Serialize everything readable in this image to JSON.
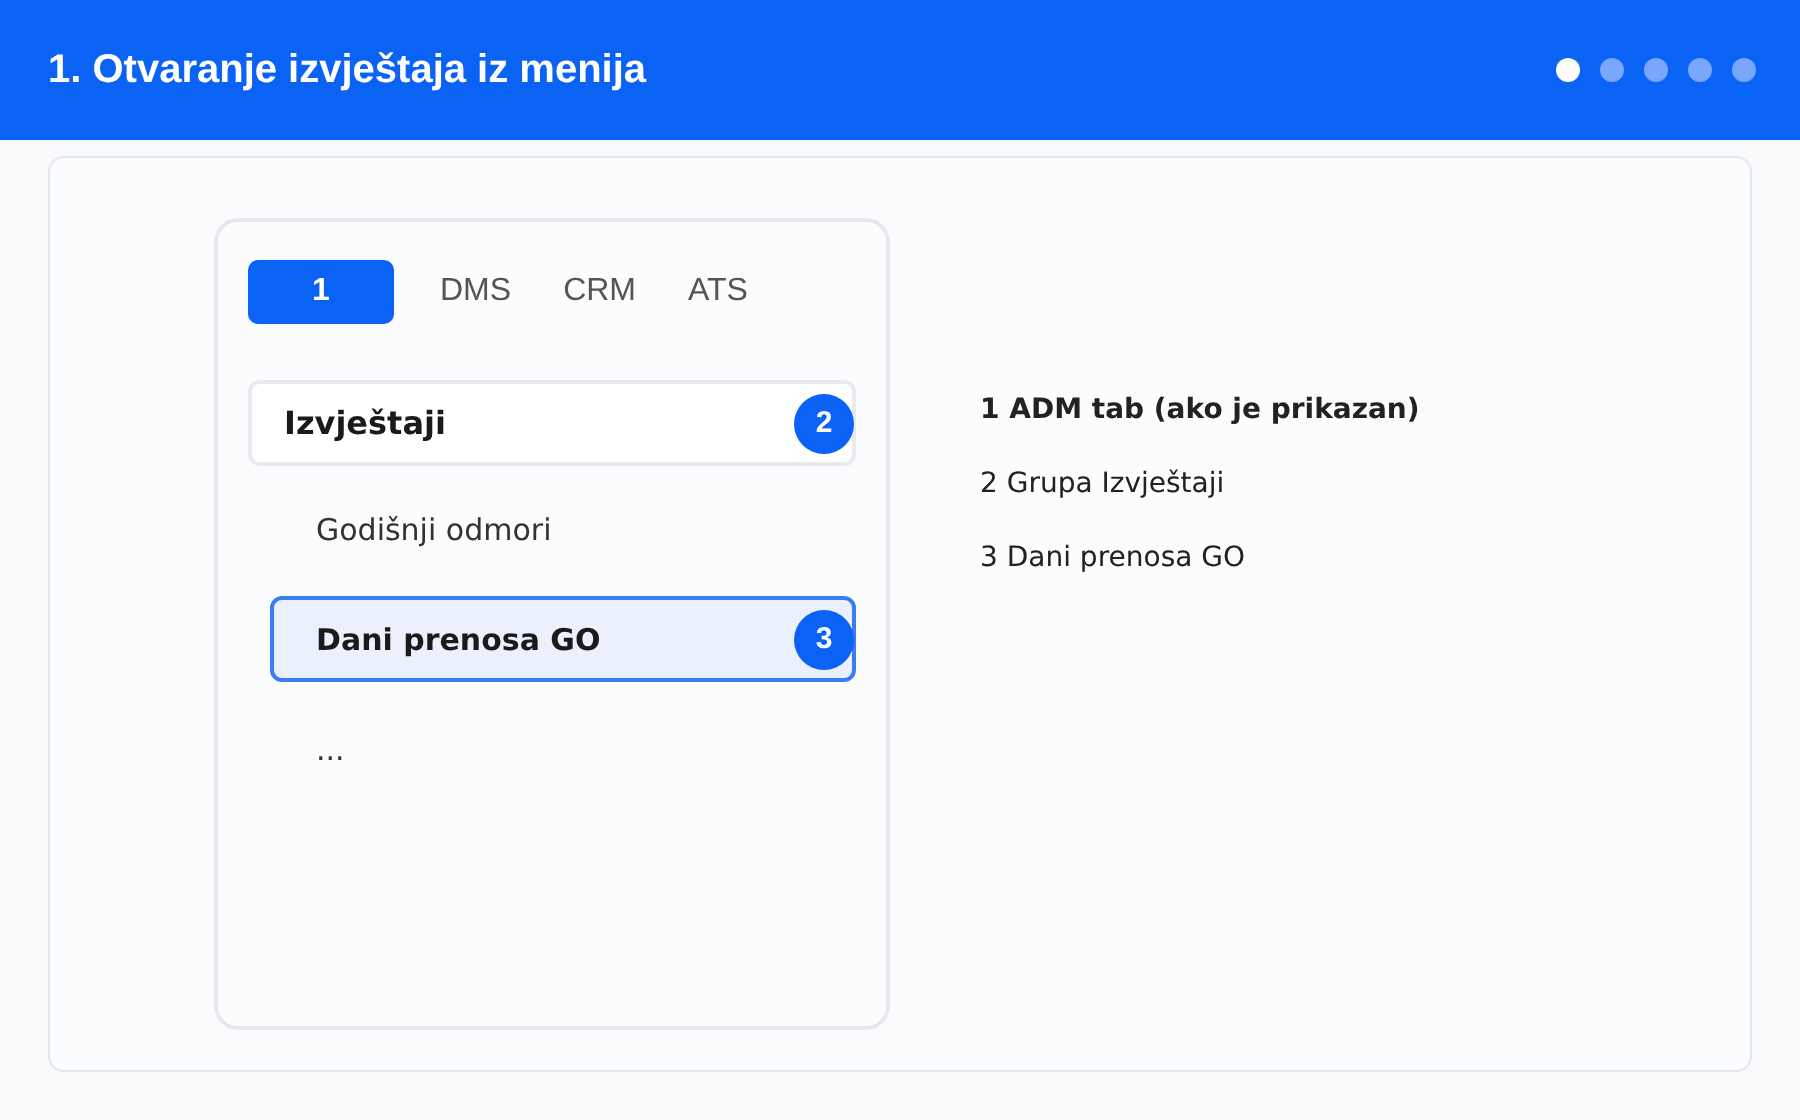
{
  "header": {
    "title": "1. Otvaranje izvještaja iz menija",
    "steps": [
      {
        "selected": true
      },
      {
        "selected": false
      },
      {
        "selected": false
      },
      {
        "selected": false
      },
      {
        "selected": false
      }
    ]
  },
  "menu": {
    "tabs": [
      {
        "selected": true,
        "badge": "1"
      },
      {
        "label": "DMS",
        "selected": false
      },
      {
        "label": "CRM",
        "selected": false
      },
      {
        "label": "ATS",
        "selected": false
      }
    ],
    "group": {
      "label": "Izvještaji",
      "badge": "2"
    },
    "items": [
      {
        "label": "Godišnji odmori",
        "selected": false
      },
      {
        "label": "Dani prenosa GO",
        "selected": true,
        "badge": "3"
      },
      {
        "label": "...",
        "selected": false
      }
    ]
  },
  "legend": [
    {
      "text": "1 ADM tab (ako je prikazan)",
      "bold": true
    },
    {
      "text": "2 Grupa Izvještaji",
      "bold": false
    },
    {
      "text": "3 Dani prenosa GO",
      "bold": false
    }
  ]
}
